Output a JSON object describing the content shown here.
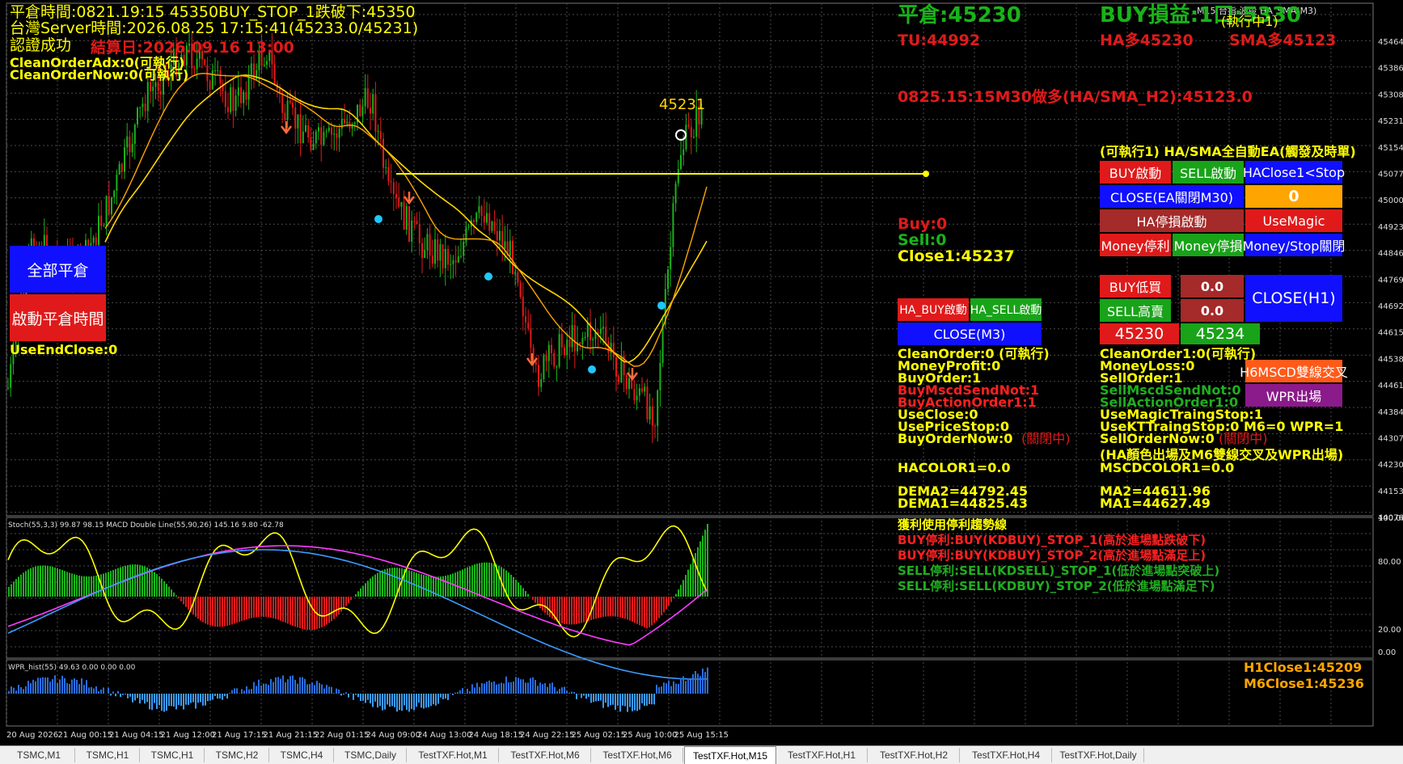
{
  "header": {
    "close_time_line": "平倉時間:0821.19:15 45350BUY_STOP_1跌破下:45350",
    "server_time": "台灣Server時間:2026.08.25 17:15:41(45233.0/45231)",
    "auth_ok": "認證成功",
    "settle_day": "結算日:2026.09.16 13:00",
    "clean_order_adx": "CleanOrderAdx:0(可執行)",
    "clean_order_now": "CleanOrderNow:0(可執行)",
    "window_title": "M15 台指 波段 HA_SMA(M3)"
  },
  "left_panel": {
    "close_all": "全部平倉",
    "start_close_time": "啟動平倉時間",
    "use_end_close": "UseEndClose:0"
  },
  "top_status": {
    "close_price": "平倉:45230",
    "buy_pl": "BUY損益:1口:5330",
    "running": "(執行中1)",
    "tu": "TU:44992",
    "ha_long": "HA多45230",
    "sma_long": "SMA多45123",
    "signal": "0825.15:15M30做多(HA/SMA_H2):45123.0"
  },
  "ea_panel": {
    "title": "(可執行1)  HA/SMA全自動EA(觸發及時單)",
    "buy_start": "BUY啟動",
    "sell_start": "SELL啟動",
    "ha_close_stop": "HAClose1<Stop",
    "close_ea": "CLOSE(EA關閉M30)",
    "zero_value": "0",
    "ha_stop_loss": "HA停損啟動",
    "use_magic": "UseMagic",
    "money_tp": "Money停利",
    "money_sl": "Money停損",
    "money_stop_off": "Money/Stop關閉",
    "buy_low": "BUY低買",
    "buy_low_val": "0.0",
    "sell_high": "SELL高賣",
    "sell_high_val": "0.0",
    "close_h1": "CLOSE(H1)",
    "price_a": "45230",
    "price_b": "45234",
    "macd_cross": "H6MSCD雙線交叉",
    "wpr_exit": "WPR出場"
  },
  "mid_panel": {
    "buy": "Buy:0",
    "sell": "Sell:0",
    "close1": "Close1:45237",
    "ha_buy": "HA_BUY啟動",
    "ha_sell": "HA_SELL啟動",
    "close_m3": "CLOSE(M3)"
  },
  "info_left": [
    {
      "text": "CleanOrder:0 (可執行)",
      "color": "#ffff00"
    },
    {
      "text": "MoneyProfit:0",
      "color": "#ffff00"
    },
    {
      "text": "BuyOrder:1",
      "color": "#ffff00"
    },
    {
      "text": "BuyMscdSendNot:1",
      "color": "#ff2020"
    },
    {
      "text": "BuyActionOrder1:1",
      "color": "#ff2020"
    },
    {
      "text": "UseClose:0",
      "color": "#ffff00"
    },
    {
      "text": "UsePriceStop:0",
      "color": "#ffff00"
    },
    {
      "text": "BuyOrderNow:0",
      "color": "#ffff00"
    }
  ],
  "info_left_suffix": "(關閉中)",
  "info_right": [
    {
      "text": "CleanOrder1:0(可執行)",
      "color": "#ffff00"
    },
    {
      "text": "MoneyLoss:0",
      "color": "#ffff00"
    },
    {
      "text": "SellOrder:1",
      "color": "#ffff00"
    },
    {
      "text": "SellMscdSendNot:0",
      "color": "#1fae1f"
    },
    {
      "text": "SellActionOrder1:0",
      "color": "#1fae1f"
    },
    {
      "text": "UseMagicTraingStop:1",
      "color": "#ffff00"
    },
    {
      "text": "UseKTTraingStop:0  M6=0  WPR=1",
      "color": "#ffff00"
    },
    {
      "text": "SellOrderNow:0",
      "color": "#ffff00"
    }
  ],
  "info_right_suffix": "(關閉中)",
  "exit_note": "(HA顏色出場及M6雙線交叉及WPR出場)",
  "ha_color": "HACOLOR1=0.0",
  "mscd_color": "MSCDCOLOR1=0.0",
  "dema2": "DEMA2=44792.45",
  "dema1": "DEMA1=44825.43",
  "ma2": "MA2=44611.96",
  "ma1": "MA1=44627.49",
  "trend_notes": [
    {
      "text": "獲利使用停利趨勢線",
      "color": "#ffff00"
    },
    {
      "text": "BUY停利:BUY(KDBUY)_STOP_1(高於進場點跌破下)",
      "color": "#ff2020"
    },
    {
      "text": "BUY停利:BUY(KDBUY)_STOP_2(高於進場點滿足上)",
      "color": "#ff2020"
    },
    {
      "text": "SELL停利:SELL(KDSELL)_STOP_1(低於進場點突破上)",
      "color": "#1fae1f"
    },
    {
      "text": "SELL停利:SELL(KDBUY)_STOP_2(低於進場點滿足下)",
      "color": "#1fae1f"
    }
  ],
  "h1_close": "H1Close1:45209",
  "m6_close": "M6Close1:45236",
  "price_label": "45231",
  "indicator1_label": "Stoch(55,3,3) 99.87 98.15 MACD Double Line(55,90,26) 145.16 9.80 -62.78",
  "indicator2_label": "WPR_hist(55) 49.63 0.00 0.00 0.00",
  "price_axis": [
    "45464",
    "45386",
    "45308",
    "45231",
    "45154",
    "45077",
    "45000",
    "44923",
    "44846",
    "44769",
    "44692",
    "44615",
    "44538",
    "44461",
    "44384",
    "44307",
    "44230",
    "44153",
    "44076"
  ],
  "osc_axis": [
    "100.00",
    "80.00",
    "20.00",
    "0.00"
  ],
  "time_axis": [
    "20 Aug 2026",
    "21 Aug 00:15",
    "21 Aug 04:15",
    "21 Aug 12:00",
    "21 Aug 17:15",
    "21 Aug 21:15",
    "22 Aug 01:15",
    "24 Aug 09:00",
    "24 Aug 13:00",
    "24 Aug 18:15",
    "24 Aug 22:15",
    "25 Aug 02:15",
    "25 Aug 10:00",
    "25 Aug 15:15"
  ],
  "tabs": [
    "TSMC,M1",
    "TSMC,H1",
    "TSMC,H1",
    "TSMC,H2",
    "TSMC,H4",
    "TSMC,Daily",
    "TestTXF.Hot,M1",
    "TestTXF.Hot,M6",
    "TestTXF.Hot,M6",
    "TestTXF.Hot,M15",
    "TestTXF.Hot,H1",
    "TestTXF.Hot,H2",
    "TestTXF.Hot,H4",
    "TestTXF.Hot,Daily"
  ],
  "active_tab": 9,
  "colors": {
    "bull": "#19b319",
    "bear": "#e01a1a",
    "ma": "#ffd700",
    "ma2": "#ffa500",
    "grid": "#4a4a4a"
  }
}
